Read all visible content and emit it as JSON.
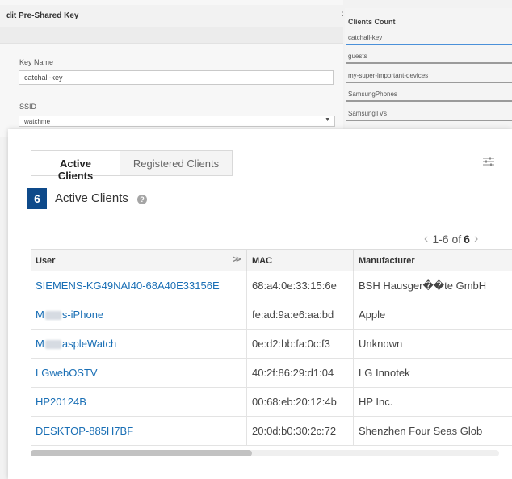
{
  "edit_panel": {
    "title": "dit Pre-Shared Key",
    "key_name_label": "Key Name",
    "key_name_value": "catchall-key",
    "ssid_label": "SSID",
    "ssid_value": "watchme"
  },
  "clients_panel": {
    "title": "Clients Count",
    "rows": [
      {
        "name": "catchall-key",
        "active": true
      },
      {
        "name": "guests",
        "active": false
      },
      {
        "name": "my-super-important-devices",
        "active": false
      },
      {
        "name": "SamsungPhones",
        "active": false
      },
      {
        "name": "SamsungTVs",
        "active": false
      }
    ]
  },
  "card": {
    "tabs": [
      "Active Clients",
      "Registered Clients"
    ],
    "active_count": "6",
    "active_label": "Active Clients",
    "pagination": {
      "range": "1-6 of",
      "total": "6"
    },
    "columns": [
      "User",
      "MAC",
      "Manufacturer"
    ],
    "rows": [
      {
        "user": "SIEMENS-KG49NAI40-68A40E33156E",
        "mac": "68:a4:0e:33:15:6e",
        "manufacturer": "BSH Hausger��te GmbH"
      },
      {
        "user_prefix": "M",
        "user_suffix": "s-iPhone",
        "mac": "fe:ad:9a:e6:aa:bd",
        "manufacturer": "Apple"
      },
      {
        "user_prefix": "M",
        "user_suffix": "aspleWatch",
        "mac": "0e:d2:bb:fa:0c:f3",
        "manufacturer": "Unknown"
      },
      {
        "user": "LGwebOSTV",
        "mac": "40:2f:86:29:d1:04",
        "manufacturer": "LG Innotek"
      },
      {
        "user": "HP20124B",
        "mac": "00:68:eb:20:12:4b",
        "manufacturer": "HP Inc."
      },
      {
        "user": "DESKTOP-885H7BF",
        "mac": "20:0d:b0:30:2c:72",
        "manufacturer": "Shenzhen Four Seas Glob"
      }
    ]
  },
  "colors": {
    "link": "#1a6fb5",
    "badge": "#0e4a8a",
    "active_underline": "#4a90d9"
  }
}
